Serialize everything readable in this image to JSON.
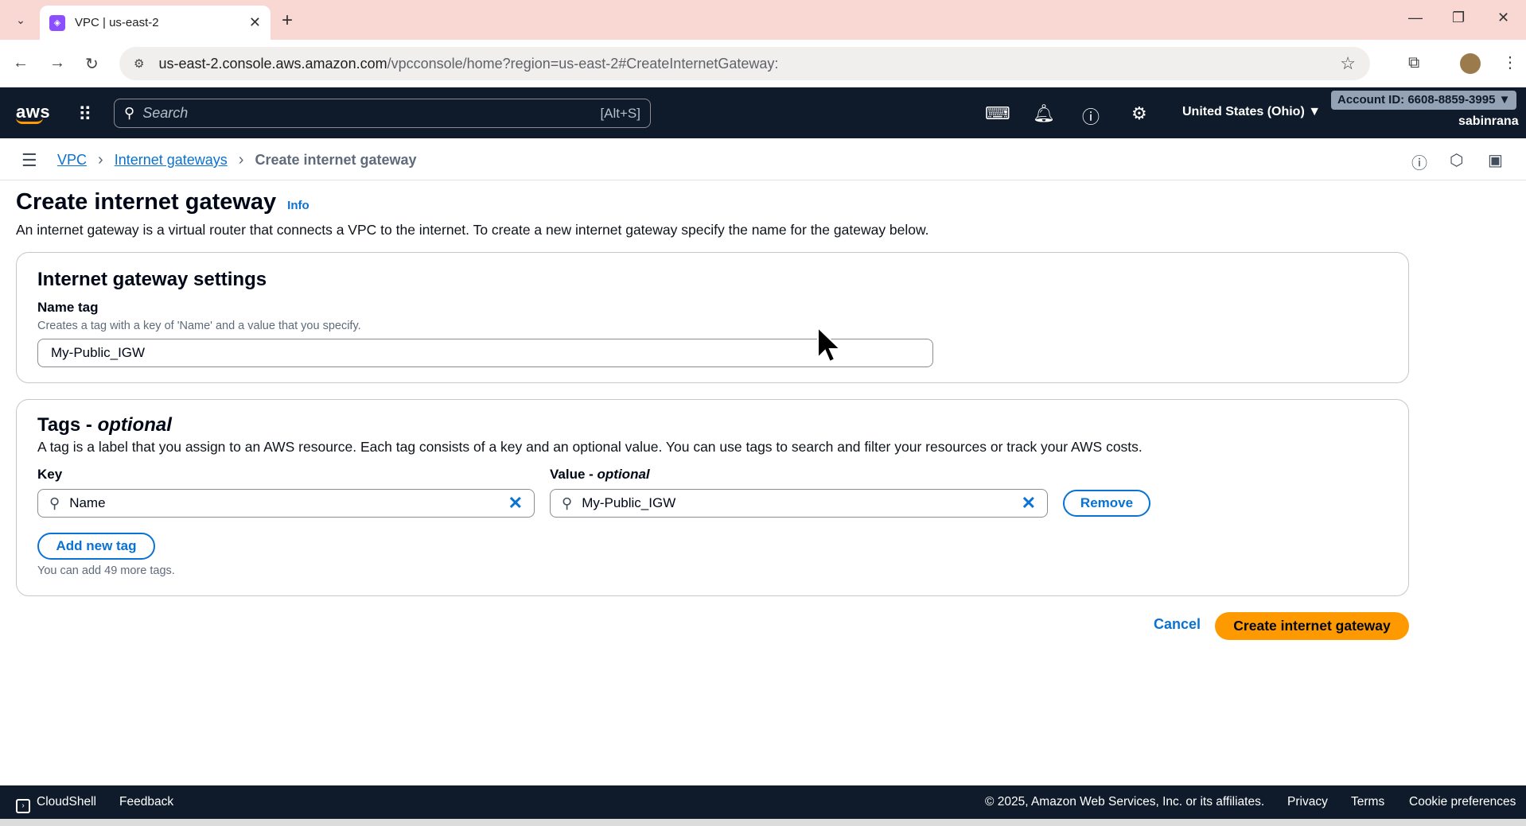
{
  "browser": {
    "tab_title": "VPC | us-east-2",
    "url_host": "us-east-2.console.aws.amazon.com",
    "url_path": "/vpcconsole/home?region=us-east-2#CreateInternetGateway:"
  },
  "aws_nav": {
    "logo": "aws",
    "search_placeholder": "Search",
    "search_shortcut": "[Alt+S]",
    "region": "United States (Ohio) ▼",
    "account": "Account ID: 6608-8859-3995 ▼",
    "user": "sabinrana"
  },
  "breadcrumb": {
    "items": [
      "VPC",
      "Internet gateways"
    ],
    "current": "Create internet gateway"
  },
  "page": {
    "title": "Create internet gateway",
    "info": "Info",
    "description": "An internet gateway is a virtual router that connects a VPC to the internet. To create a new internet gateway specify the name for the gateway below."
  },
  "settings_panel": {
    "title": "Internet gateway settings",
    "name_tag_label": "Name tag",
    "name_tag_desc": "Creates a tag with a key of 'Name' and a value that you specify.",
    "name_tag_value": "My-Public_IGW"
  },
  "tags_panel": {
    "title_main": "Tags - ",
    "title_italic": "optional",
    "description": "A tag is a label that you assign to an AWS resource. Each tag consists of a key and an optional value. You can use tags to search and filter your resources or track your AWS costs.",
    "key_label": "Key",
    "value_label_main": "Value - ",
    "value_label_italic": "optional",
    "key_value": "Name",
    "value_value": "My-Public_IGW",
    "remove_label": "Remove",
    "add_tag_label": "Add new tag",
    "remaining_note": "You can add 49 more tags."
  },
  "actions": {
    "cancel": "Cancel",
    "create": "Create internet gateway"
  },
  "footer": {
    "cloudshell": "CloudShell",
    "feedback": "Feedback",
    "copyright": "© 2025, Amazon Web Services, Inc. or its affiliates.",
    "privacy": "Privacy",
    "terms": "Terms",
    "cookies": "Cookie preferences"
  },
  "colors": {
    "nav_bg": "#0f1b2a",
    "link": "#0972d3",
    "primary_button": "#ff9900",
    "tabbar": "#f9d8d3"
  }
}
